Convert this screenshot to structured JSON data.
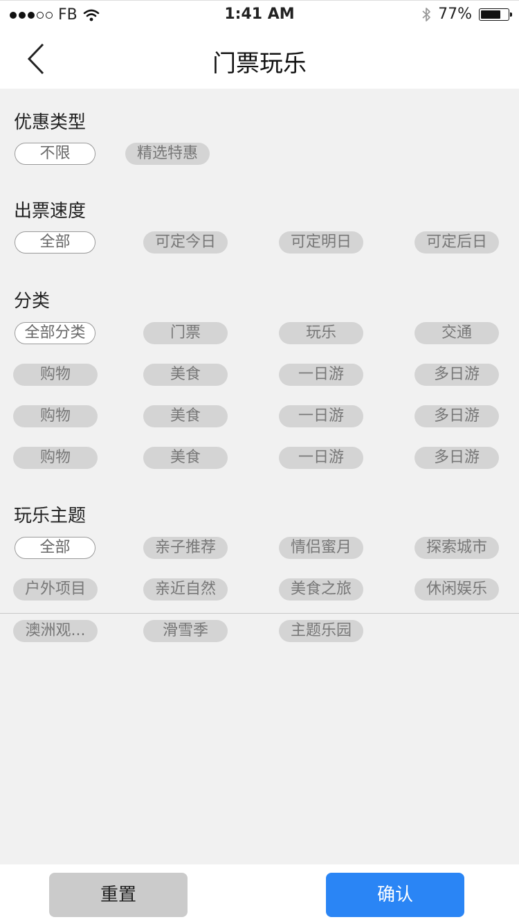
{
  "status_bar": {
    "carrier": "FB",
    "time": "1:41 AM",
    "battery_percent": "77%",
    "battery_level": 0.77,
    "icons": [
      "signal-dots-icon",
      "wifi-icon",
      "bluetooth-icon",
      "battery-icon"
    ]
  },
  "nav": {
    "title": "门票玩乐",
    "back_icon": "chevron-left-icon"
  },
  "sections": {
    "discount": {
      "title": "优惠类型",
      "tags": [
        "不限",
        "精选特惠"
      ]
    },
    "speed": {
      "title": "出票速度",
      "tags": [
        "全部",
        "可定今日",
        "可定明日",
        "可定后日"
      ]
    },
    "category": {
      "title": "分类",
      "tags": [
        "全部分类",
        "门票",
        "玩乐",
        "交通",
        "购物",
        "美食",
        "一日游",
        "多日游",
        "购物",
        "美食",
        "一日游",
        "多日游",
        "购物",
        "美食",
        "一日游",
        "多日游"
      ]
    },
    "theme": {
      "title": "玩乐主题",
      "tags": [
        "全部",
        "亲子推荐",
        "情侣蜜月",
        "探索城市",
        "户外项目",
        "亲近自然",
        "美食之旅",
        "休闲娱乐",
        "澳洲观...",
        "滑雪季",
        "主题乐园"
      ]
    }
  },
  "footer": {
    "reset_label": "重置",
    "confirm_label": "确认"
  },
  "colors": {
    "background": "#f1f1f1",
    "tag_bg": "#d4d4d4",
    "tag_text": "#777777",
    "confirm": "#2a85f5",
    "reset": "#cbcbcb"
  }
}
